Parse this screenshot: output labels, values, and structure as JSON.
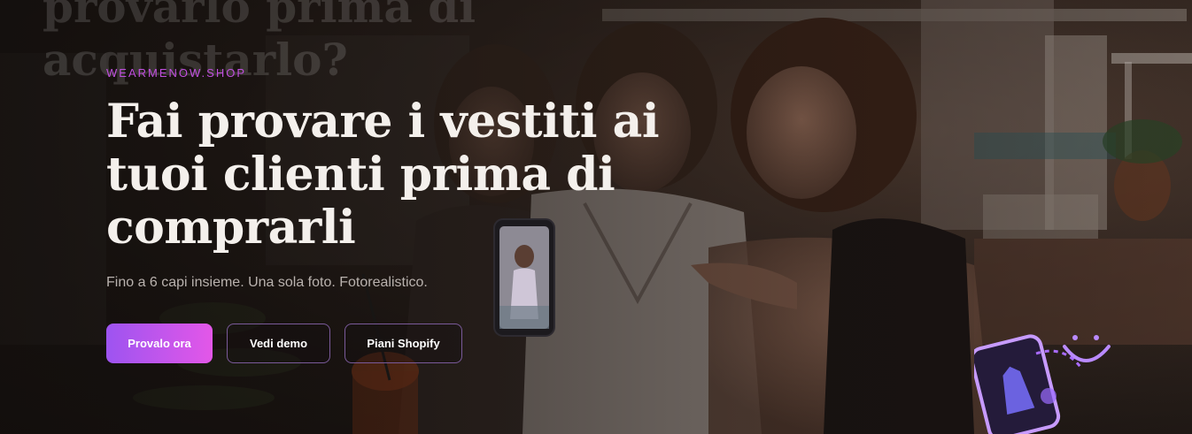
{
  "ghost_heading": "provarlo prima di acquistarlo?",
  "hero": {
    "eyebrow": "WEARMENOW.SHOP",
    "headline": "Fai provare i vestiti ai tuoi clienti prima di comprarli",
    "subtitle": "Fino a 6 capi insieme. Una sola foto. Fotorealistico."
  },
  "buttons": {
    "primary": "Provalo ora",
    "demo": "Vedi demo",
    "shopify": "Piani Shopify"
  },
  "colors": {
    "accent_purple": "#a855f7",
    "accent_pink": "#e357e8",
    "eyebrow": "#c14fe0",
    "headline": "#f4f0ec"
  },
  "icons": [
    "phone-dress-sticker-icon",
    "smile-icon",
    "phone-photo-icon"
  ]
}
